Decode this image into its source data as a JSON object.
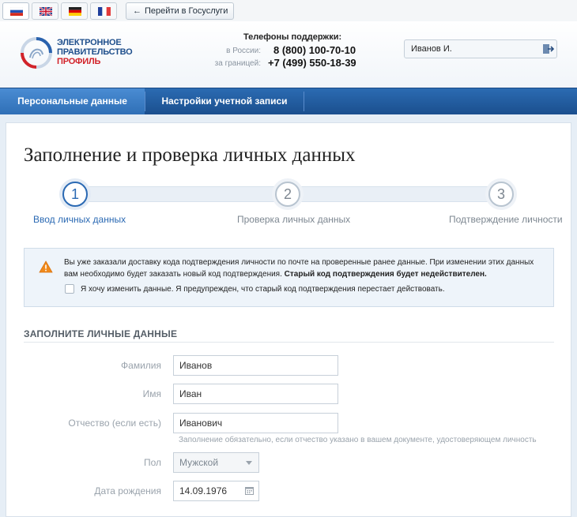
{
  "topbar": {
    "languages": [
      {
        "code": "ru",
        "icon": "russian-flag-icon",
        "active": true
      },
      {
        "code": "en",
        "icon": "uk-flag-icon",
        "active": false
      },
      {
        "code": "de",
        "icon": "german-flag-icon",
        "active": false
      },
      {
        "code": "fr",
        "icon": "french-flag-icon",
        "active": false
      }
    ],
    "gosuslugi_arrow": "←",
    "gosuslugi_label": "Перейти в Госуслуги"
  },
  "header": {
    "logo_line1": "ЭЛЕКТРОННОЕ",
    "logo_line2": "ПРАВИТЕЛЬСТВО",
    "logo_line3": "ПРОФИЛЬ",
    "phones_title": "Телефоны поддержки:",
    "phone_ru_label": "в России:",
    "phone_ru": "8 (800) 100-70-10",
    "phone_abroad_label": "за границей:",
    "phone_abroad": "+7 (499) 550-18-39",
    "user_name": "Иванов И.",
    "colors": {
      "brand_blue": "#1f4f8c",
      "brand_red": "#d2232a"
    }
  },
  "nav": {
    "tabs": [
      {
        "label": "Персональные данные",
        "active": true
      },
      {
        "label": "Настройки учетной записи",
        "active": false
      }
    ],
    "colors": {
      "bar": "#1b4f8e",
      "active": "#3a7cc4"
    }
  },
  "page": {
    "title": "Заполнение и проверка личных данных",
    "steps": [
      {
        "num": "1",
        "label": "Ввод личных данных",
        "active": true
      },
      {
        "num": "2",
        "label": "Проверка личных данных",
        "active": false
      },
      {
        "num": "3",
        "label": "Подтверждение личности",
        "active": false
      }
    ],
    "alert": {
      "text": "Вы уже заказали доставку кода подтверждения личности по почте на проверенные ранее данные. При изменении этих данных вам необходимо будет заказать новый код подтверждения.",
      "text_bold": "Старый код подтверждения будет недействителен.",
      "checkbox_label": "Я хочу изменить данные. Я предупрежден, что старый код подтверждения перестает действовать.",
      "checkbox_checked": false
    },
    "section_title": "ЗАПОЛНИТЕ ЛИЧНЫЕ ДАННЫЕ",
    "form": {
      "surname_label": "Фамилия",
      "surname_value": "Иванов",
      "name_label": "Имя",
      "name_value": "Иван",
      "patronymic_label": "Отчество (если есть)",
      "patronymic_value": "Иванович",
      "patronymic_hint": "Заполнение обязательно, если отчество указано в вашем документе, удостоверяющем личность",
      "gender_label": "Пол",
      "gender_value": "Мужской",
      "birthdate_label": "Дата рождения",
      "birthdate_value": "14.09.1976"
    }
  }
}
